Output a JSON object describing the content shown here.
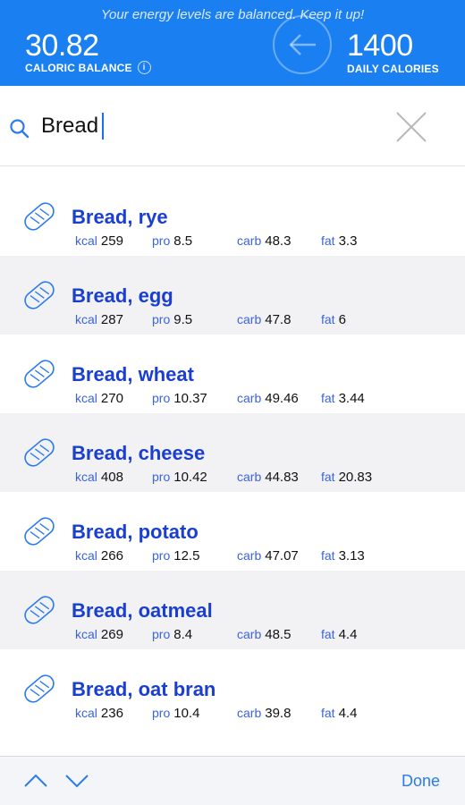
{
  "header": {
    "banner": "Your energy levels are balanced. Keep it up!",
    "caloric_balance_value": "30.82",
    "caloric_balance_label": "CALORIC BALANCE",
    "info_glyph": "i",
    "daily_calories_value": "1400",
    "daily_calories_label": "DAILY CALORIES",
    "color": "#1a7ff0"
  },
  "search": {
    "value": "Bread",
    "icon": "search-icon",
    "clear_icon": "close-icon"
  },
  "macro_labels": {
    "kcal": "kcal",
    "pro": "pro",
    "carb": "carb",
    "fat": "fat"
  },
  "results": [
    {
      "name": "Bread, rye",
      "kcal": "259",
      "pro": "8.5",
      "carb": "48.3",
      "fat": "3.3"
    },
    {
      "name": "Bread, egg",
      "kcal": "287",
      "pro": "9.5",
      "carb": "47.8",
      "fat": "6"
    },
    {
      "name": "Bread, wheat",
      "kcal": "270",
      "pro": "10.37",
      "carb": "49.46",
      "fat": "3.44"
    },
    {
      "name": "Bread, cheese",
      "kcal": "408",
      "pro": "10.42",
      "carb": "44.83",
      "fat": "20.83"
    },
    {
      "name": "Bread, potato",
      "kcal": "266",
      "pro": "12.5",
      "carb": "47.07",
      "fat": "3.13"
    },
    {
      "name": "Bread, oatmeal",
      "kcal": "269",
      "pro": "8.4",
      "carb": "48.5",
      "fat": "4.4"
    },
    {
      "name": "Bread, oat bran",
      "kcal": "236",
      "pro": "10.4",
      "carb": "39.8",
      "fat": "4.4"
    }
  ],
  "toolbar": {
    "done_label": "Done",
    "up_icon": "chevron-up-icon",
    "down_icon": "chevron-down-icon"
  }
}
